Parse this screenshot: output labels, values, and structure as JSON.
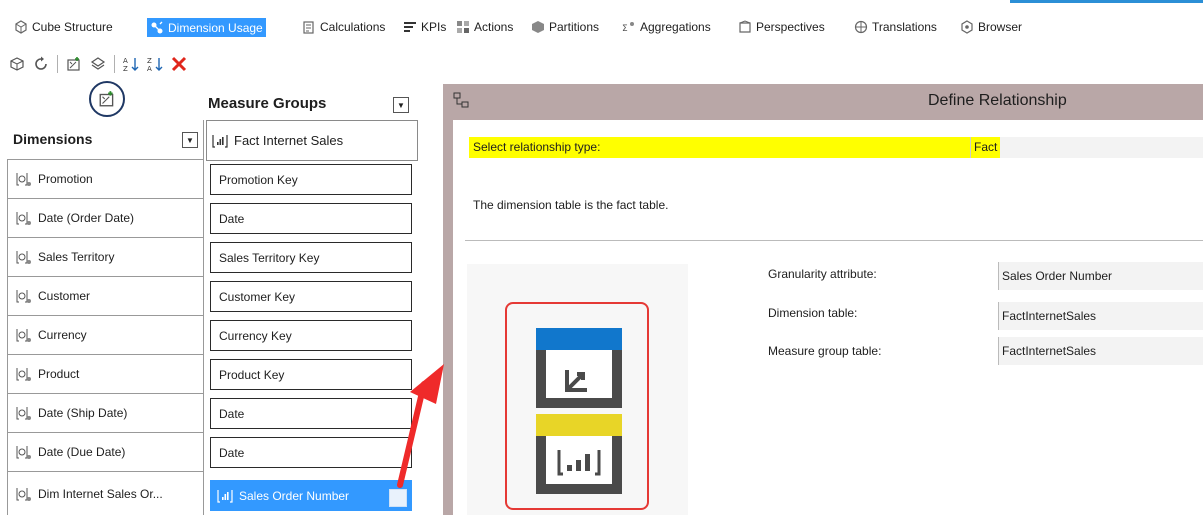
{
  "tabs": [
    {
      "label": "Cube Structure",
      "icon": "cube-structure-icon"
    },
    {
      "label": "Dimension Usage",
      "icon": "dimension-usage-icon",
      "active": true
    },
    {
      "label": "Calculations",
      "icon": "calculations-icon"
    },
    {
      "label": "KPIs",
      "icon": "kpis-icon"
    },
    {
      "label": "Actions",
      "icon": "actions-icon"
    },
    {
      "label": "Partitions",
      "icon": "partitions-icon"
    },
    {
      "label": "Aggregations",
      "icon": "aggregations-icon"
    },
    {
      "label": "Perspectives",
      "icon": "perspectives-icon"
    },
    {
      "label": "Translations",
      "icon": "translations-icon"
    },
    {
      "label": "Browser",
      "icon": "browser-icon"
    }
  ],
  "toolbar": {
    "buttons": [
      "add-cube-dimension-icon",
      "refresh-icon",
      "add-relationship-icon",
      "dimension-properties-icon",
      "sort-ascending-icon",
      "sort-descending-icon",
      "delete-icon"
    ]
  },
  "grid": {
    "measure_groups_header": "Measure Groups",
    "dimensions_header": "Dimensions",
    "measure_group": "Fact Internet Sales",
    "rows": [
      {
        "dimension": "Promotion",
        "value": "Promotion Key"
      },
      {
        "dimension": "Date (Order Date)",
        "value": "Date"
      },
      {
        "dimension": "Sales Territory",
        "value": "Sales Territory Key"
      },
      {
        "dimension": "Customer",
        "value": "Customer Key"
      },
      {
        "dimension": "Currency",
        "value": "Currency Key"
      },
      {
        "dimension": "Product",
        "value": "Product Key"
      },
      {
        "dimension": "Date (Ship Date)",
        "value": "Date"
      },
      {
        "dimension": "Date (Due Date)",
        "value": "Date"
      },
      {
        "dimension": "Dim Internet Sales Or...",
        "value": "Sales Order Number",
        "selected": true
      }
    ]
  },
  "dialog": {
    "title": "Define Relationship",
    "select_label": "Select relationship type:",
    "select_value": "Fact",
    "description": "The dimension table is the fact table.",
    "fields": [
      {
        "label": "Granularity attribute:",
        "value": "Sales Order Number"
      },
      {
        "label": "Dimension table:",
        "value": "FactInternetSales"
      },
      {
        "label": "Measure group table:",
        "value": "FactInternetSales"
      }
    ]
  },
  "colors": {
    "accent": "#3399ff",
    "highlight": "#ffff00",
    "dialog_frame": "#b9a7a7",
    "callout_red": "#e53935",
    "diagram_blue": "#1177cc",
    "diagram_yellow": "#e8d527",
    "diagram_gray": "#4a4a4a"
  }
}
